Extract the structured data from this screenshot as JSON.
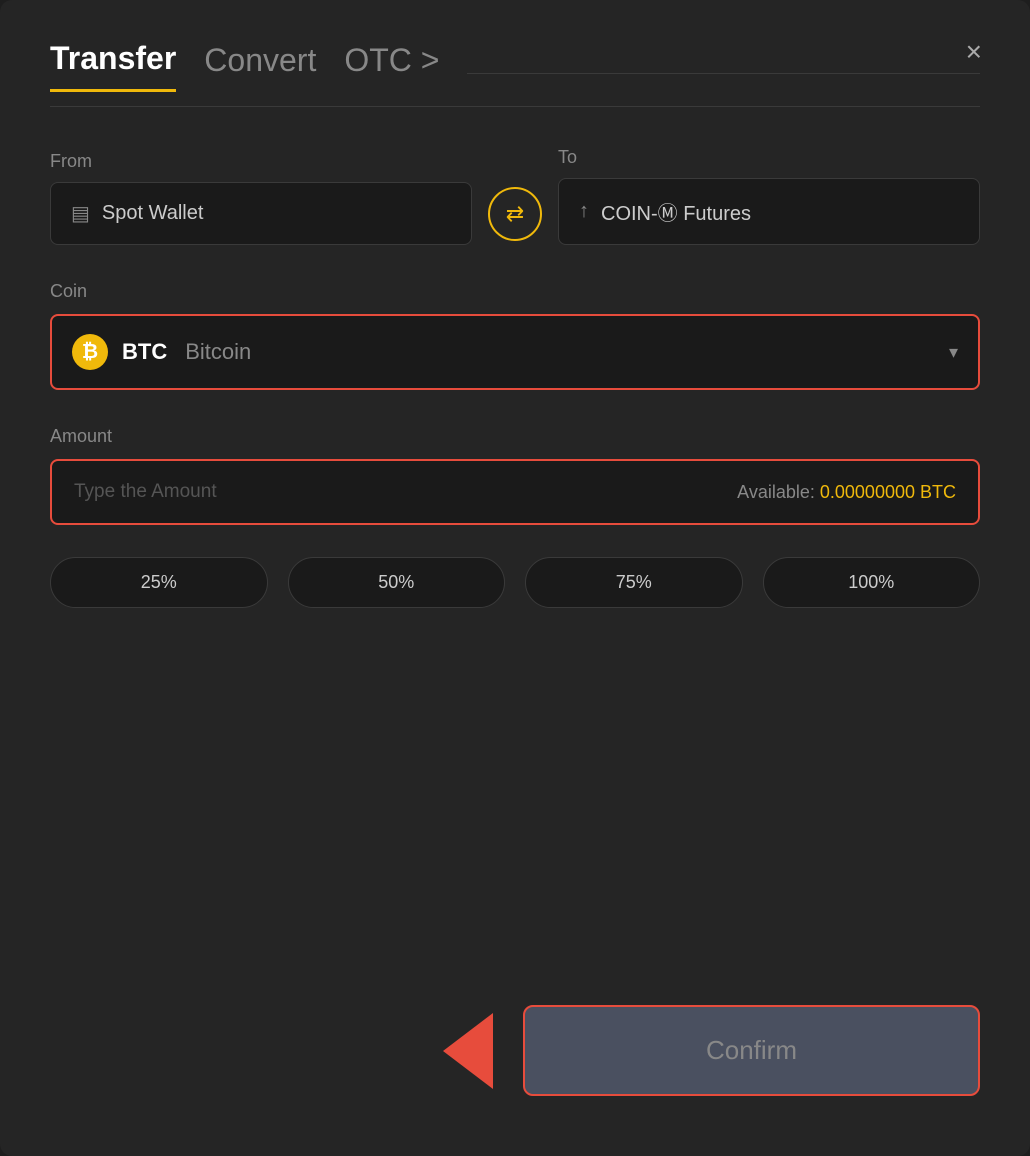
{
  "header": {
    "title": "Transfer",
    "tab_convert": "Convert",
    "tab_otc": "OTC >",
    "close_label": "×"
  },
  "from": {
    "label": "From",
    "wallet_icon": "▤",
    "wallet_name": "Spot Wallet"
  },
  "swap": {
    "icon": "⇄"
  },
  "to": {
    "label": "To",
    "wallet_icon": "↑",
    "wallet_name": "COIN-Ⓜ Futures"
  },
  "coin": {
    "label": "Coin",
    "symbol": "BTC",
    "name": "Bitcoin",
    "chevron": "▾"
  },
  "amount": {
    "label": "Amount",
    "placeholder": "Type the Amount",
    "available_label": "Available:",
    "available_value": "0.00000000 BTC"
  },
  "percentages": [
    {
      "label": "25%"
    },
    {
      "label": "50%"
    },
    {
      "label": "75%"
    },
    {
      "label": "100%"
    }
  ],
  "confirm": {
    "label": "Confirm"
  }
}
